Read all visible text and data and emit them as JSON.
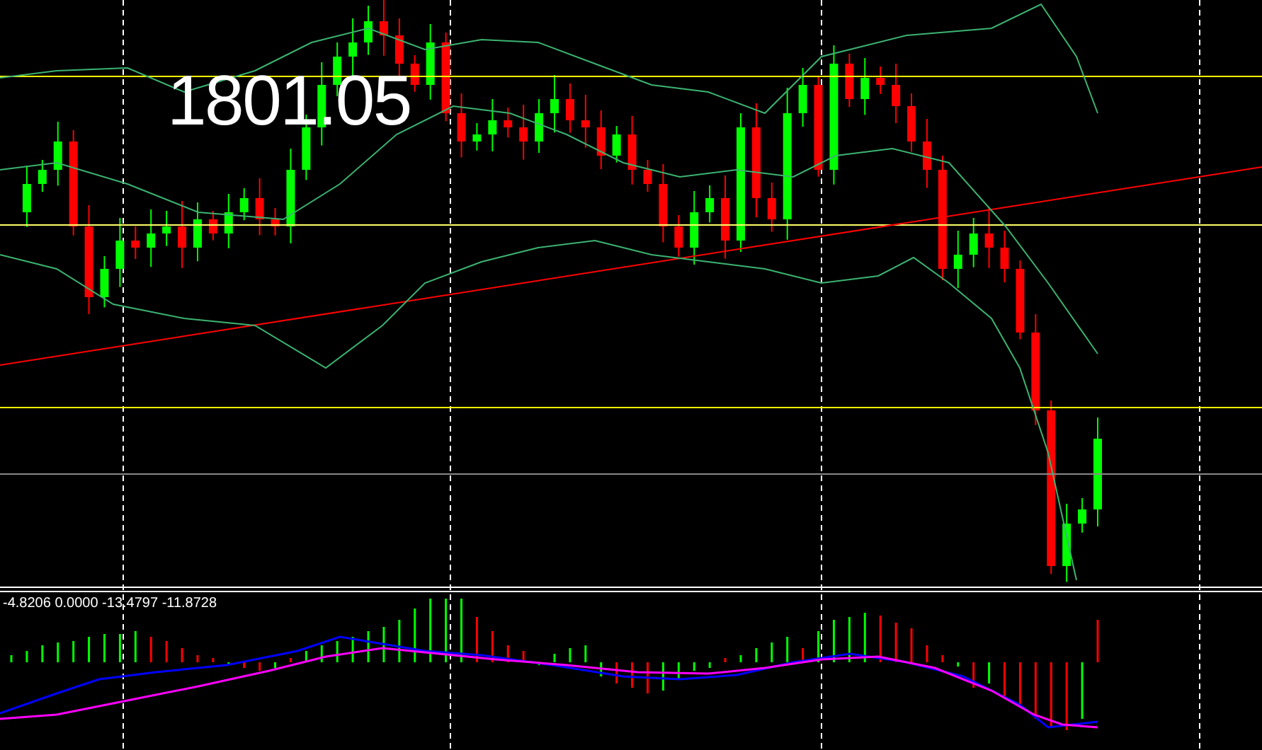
{
  "price_chart": {
    "price_label": "1801.05"
  },
  "indicator_panel": {
    "values_text": "-4.8206 0.0000 -13.4797 -11.8728"
  }
}
